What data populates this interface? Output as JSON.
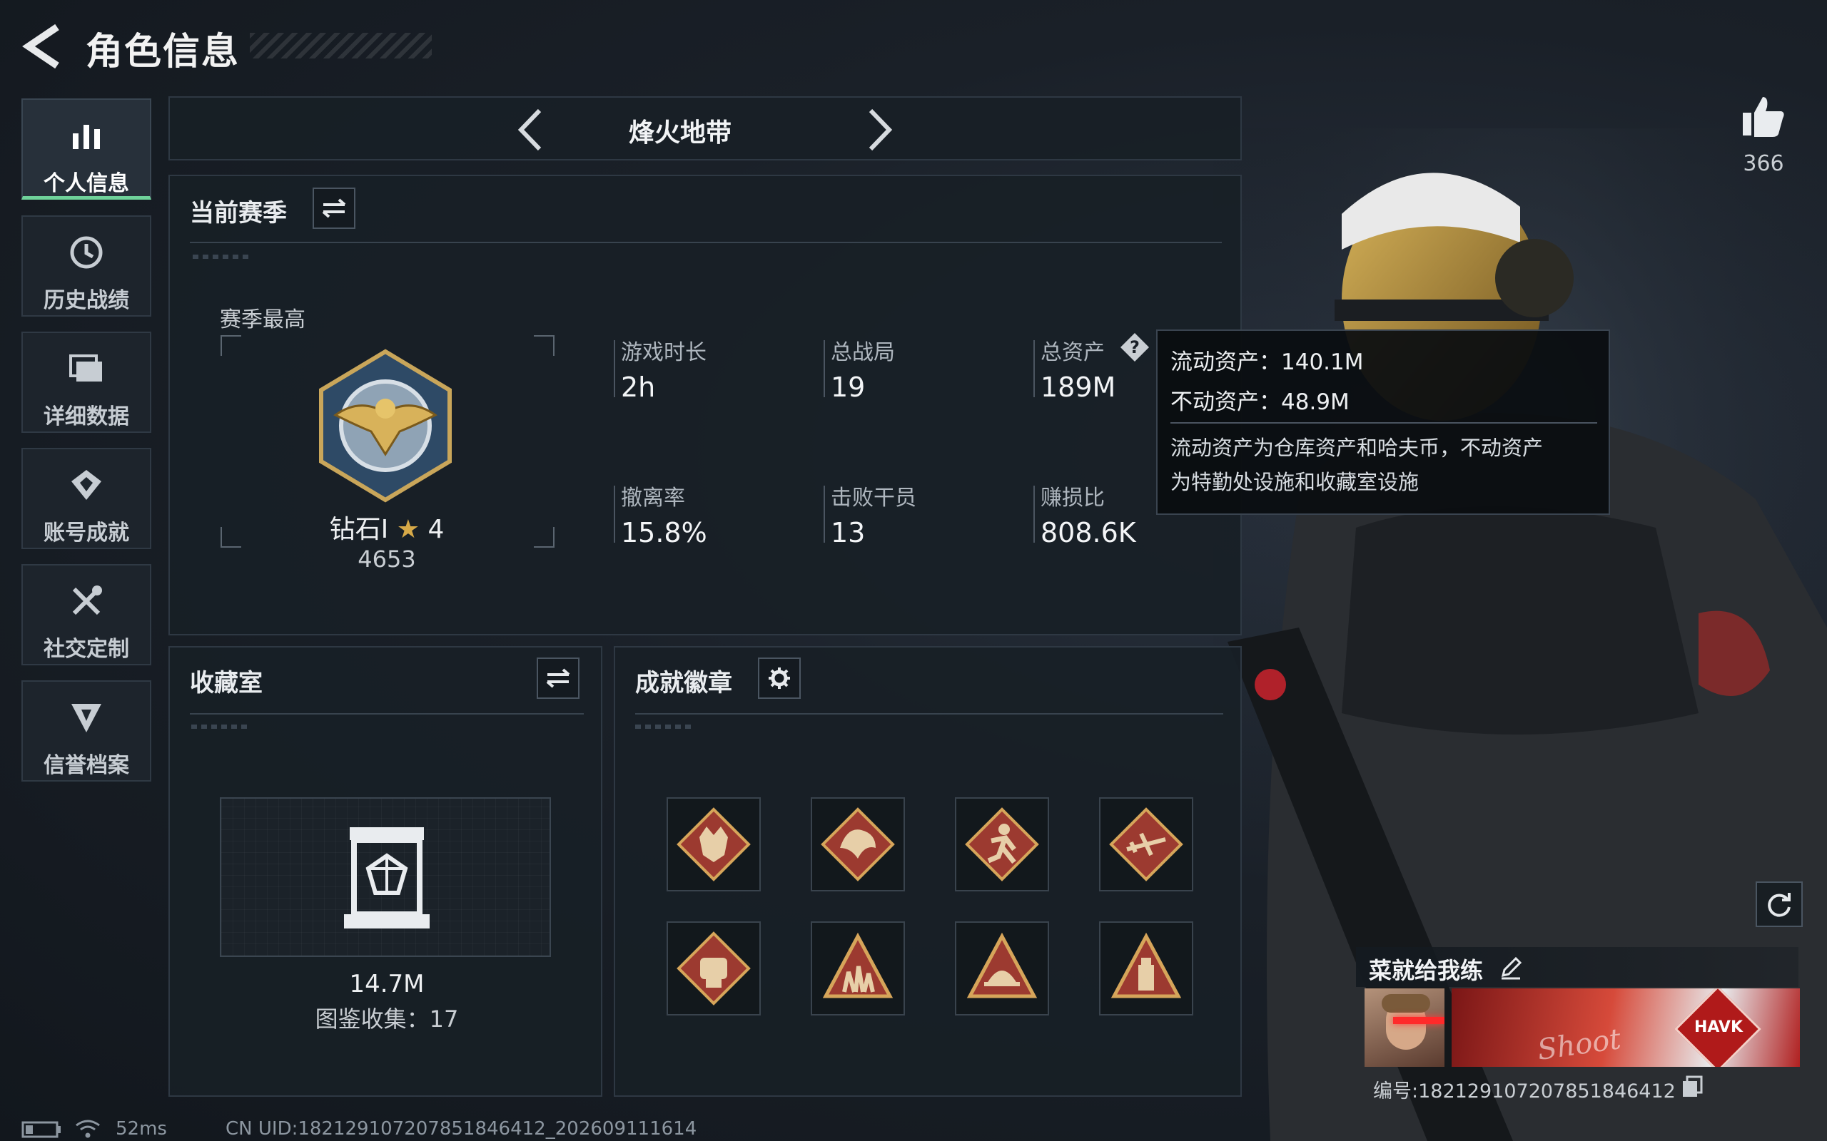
{
  "header": {
    "title": "角色信息"
  },
  "sidebar": {
    "items": [
      {
        "label": "个人信息",
        "icon": "bar-chart-icon",
        "active": true
      },
      {
        "label": "历史战绩",
        "icon": "history-icon"
      },
      {
        "label": "详细数据",
        "icon": "folder-icon"
      },
      {
        "label": "账号成就",
        "icon": "achievement-icon"
      },
      {
        "label": "社交定制",
        "icon": "tools-icon"
      },
      {
        "label": "信誉档案",
        "icon": "reputation-icon"
      }
    ]
  },
  "mode_selector": {
    "label": "烽火地带"
  },
  "season": {
    "title": "当前赛季",
    "best_label": "赛季最高",
    "rank_name": "钻石I",
    "rank_stars": "4",
    "rank_score": "4653",
    "stats": [
      {
        "label": "游戏时长",
        "value": "2h"
      },
      {
        "label": "总战局",
        "value": "19"
      },
      {
        "label": "总资产",
        "value": "189M"
      },
      {
        "label": "撤离率",
        "value": "15.8%"
      },
      {
        "label": "击败干员",
        "value": "13"
      },
      {
        "label": "赚损比",
        "value": "808.6K"
      }
    ]
  },
  "tooltip": {
    "liquid": "流动资产：140.1M",
    "fixed": "不动资产：48.9M",
    "desc_line1": "流动资产为仓库资产和哈夫币，不动资产",
    "desc_line2": "为特勤处设施和收藏室设施"
  },
  "collection": {
    "title": "收藏室",
    "value": "14.7M",
    "catalog": "图鉴收集：17"
  },
  "achievements": {
    "title": "成就徽章",
    "badges": [
      "wolf-badge-icon",
      "dragon-badge-icon",
      "runner-badge-icon",
      "aircraft-badge-icon",
      "fist-badge-icon",
      "squad-badge-icon",
      "helmet-badge-icon",
      "tower-badge-icon"
    ]
  },
  "profile": {
    "likes": "366",
    "nickname": "菜就给我练",
    "card_id": "编号:182129107207851846412",
    "banner_logo": "HAVK",
    "banner_script": "Shoot"
  },
  "footer": {
    "ping": "52ms",
    "uid": "CN UID:182129107207851846412_202609111614"
  },
  "colors": {
    "accent_green": "#6fd29a",
    "badge_red": "#b0453a",
    "badge_gold": "#d6a55a"
  }
}
